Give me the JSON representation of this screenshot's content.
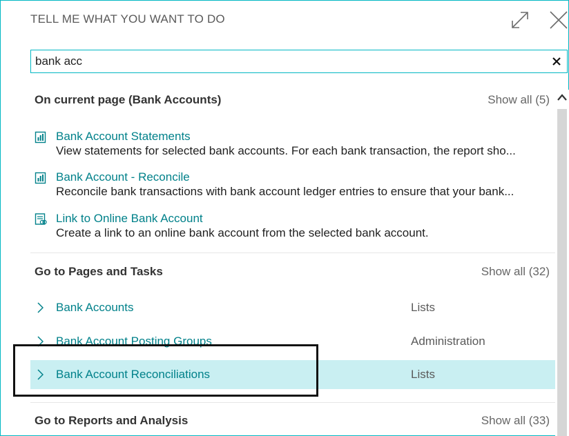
{
  "dialog": {
    "title": "TELL ME WHAT YOU WANT TO DO"
  },
  "search": {
    "value": "bank acc"
  },
  "current_page": {
    "heading": "On current page (Bank Accounts)",
    "show_all": "Show all (5)",
    "items": [
      {
        "title": "Bank Account Statements",
        "description": "View statements for selected bank accounts. For each bank transaction, the report sho...",
        "icon": "report-icon"
      },
      {
        "title": "Bank Account - Reconcile",
        "description": "Reconcile bank transactions with bank account ledger entries to ensure that your bank...",
        "icon": "report-icon"
      },
      {
        "title": "Link to Online Bank Account",
        "description": "Create a link to an online bank account from the selected bank account.",
        "icon": "link-document-icon"
      }
    ]
  },
  "pages_tasks": {
    "heading": "Go to Pages and Tasks",
    "show_all": "Show all (32)",
    "items": [
      {
        "label": "Bank Accounts",
        "category": "Lists"
      },
      {
        "label": "Bank Account Posting Groups",
        "category": "Administration"
      },
      {
        "label": "Bank Account Reconciliations",
        "category": "Lists",
        "selected": true
      }
    ]
  },
  "reports": {
    "heading": "Go to Reports and Analysis",
    "show_all": "Show all (33)"
  },
  "colors": {
    "accent": "#00b7c3",
    "link": "#00818a",
    "selected_row": "#c9eff2"
  }
}
